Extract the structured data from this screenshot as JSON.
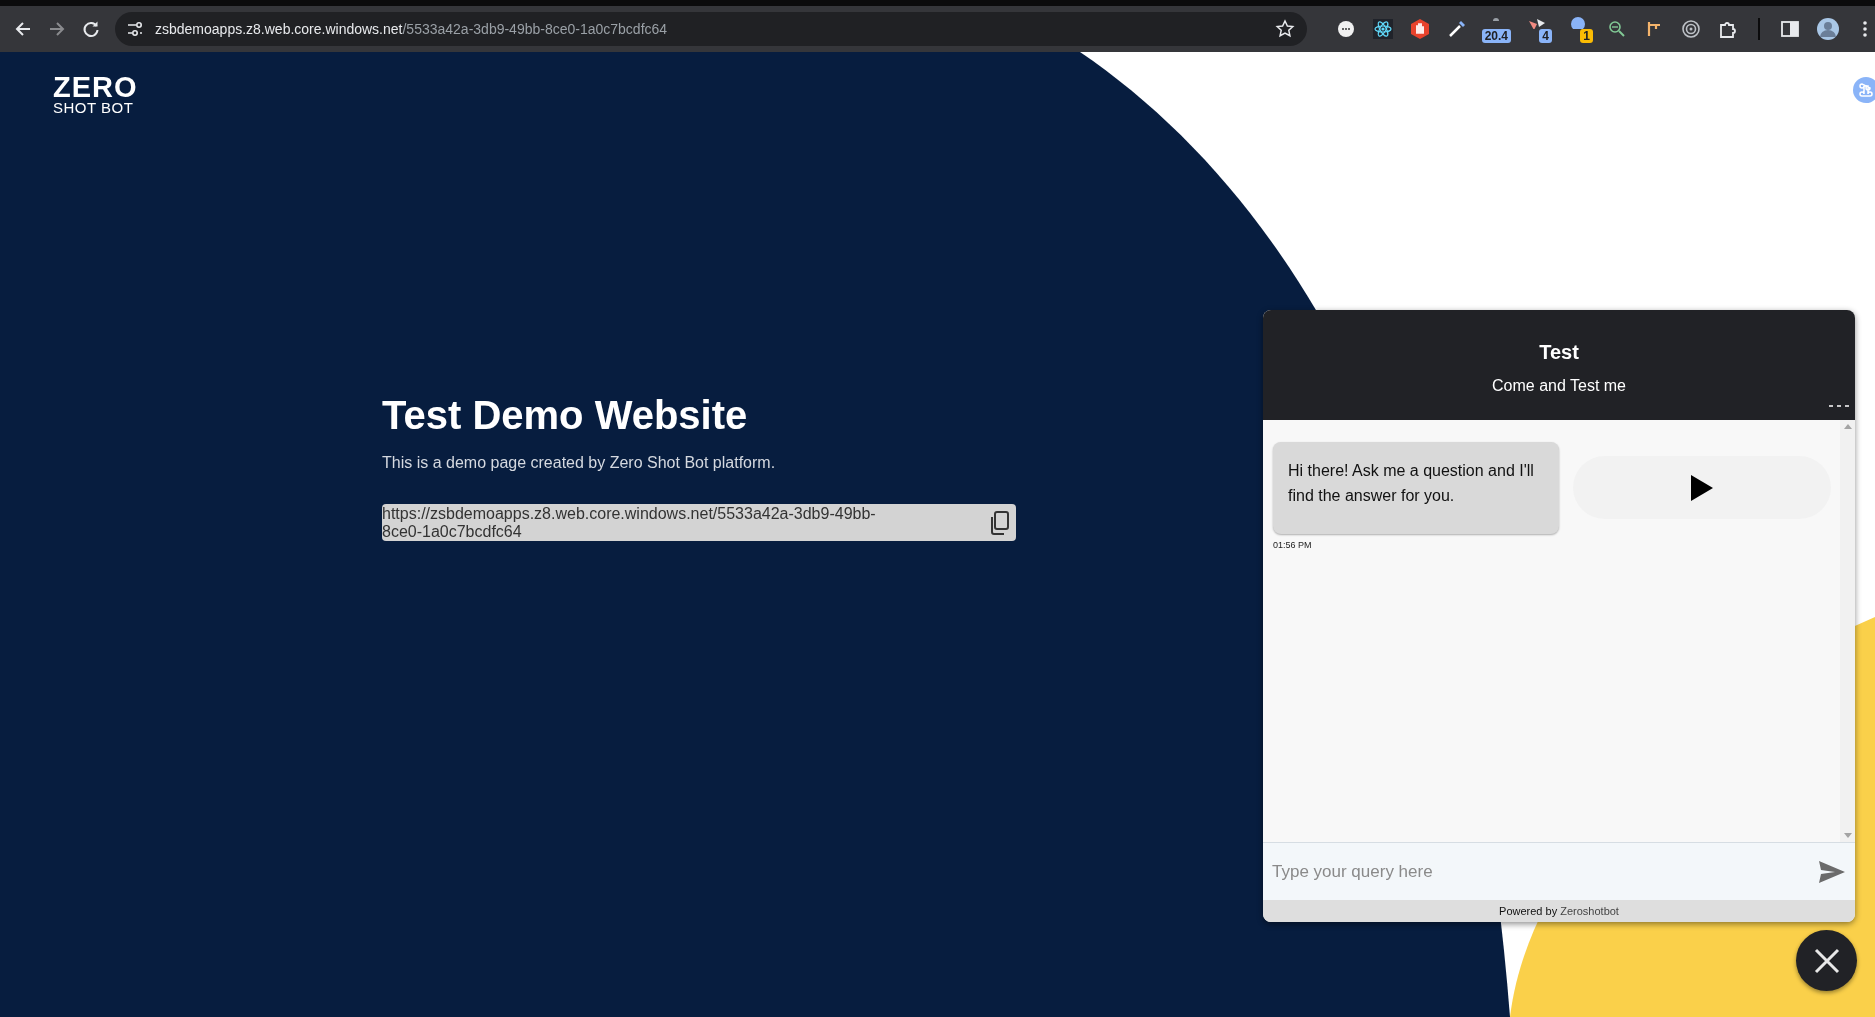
{
  "browser": {
    "url_host": "zsbdemoapps.z8.web.core.windows.net",
    "url_path": "/5533a42a-3db9-49bb-8ce0-1a0c7bcdfc64",
    "bookmarked": false,
    "extension_badges": [
      {
        "text": "20.4",
        "color": "#8ab4f8"
      },
      {
        "text": "4",
        "color": "#8ab4f8"
      },
      {
        "text": "1",
        "color": "#fbbc04"
      }
    ]
  },
  "logo": {
    "line_1": "ZERO",
    "line_2": "SHOT BOT"
  },
  "page": {
    "heading": "Test Demo Website",
    "description": "This is a demo page created by Zero Shot Bot platform.",
    "share_url": "https://zsbdemoapps.z8.web.core.windows.net/5533a42a-3db9-49bb-8ce0-1a0c7bcdfc64"
  },
  "chat": {
    "title": "Test",
    "subtitle": "Come and Test me",
    "messages": [
      {
        "text": "Hi there! Ask me a question and I'll find the answer for you.",
        "time": "01:56 PM"
      }
    ],
    "audio": {
      "playing": false
    },
    "input": {
      "placeholder": "Type your query here"
    },
    "footer": {
      "prefix": "Powered by",
      "link": "Zeroshotbot"
    },
    "open": true
  }
}
